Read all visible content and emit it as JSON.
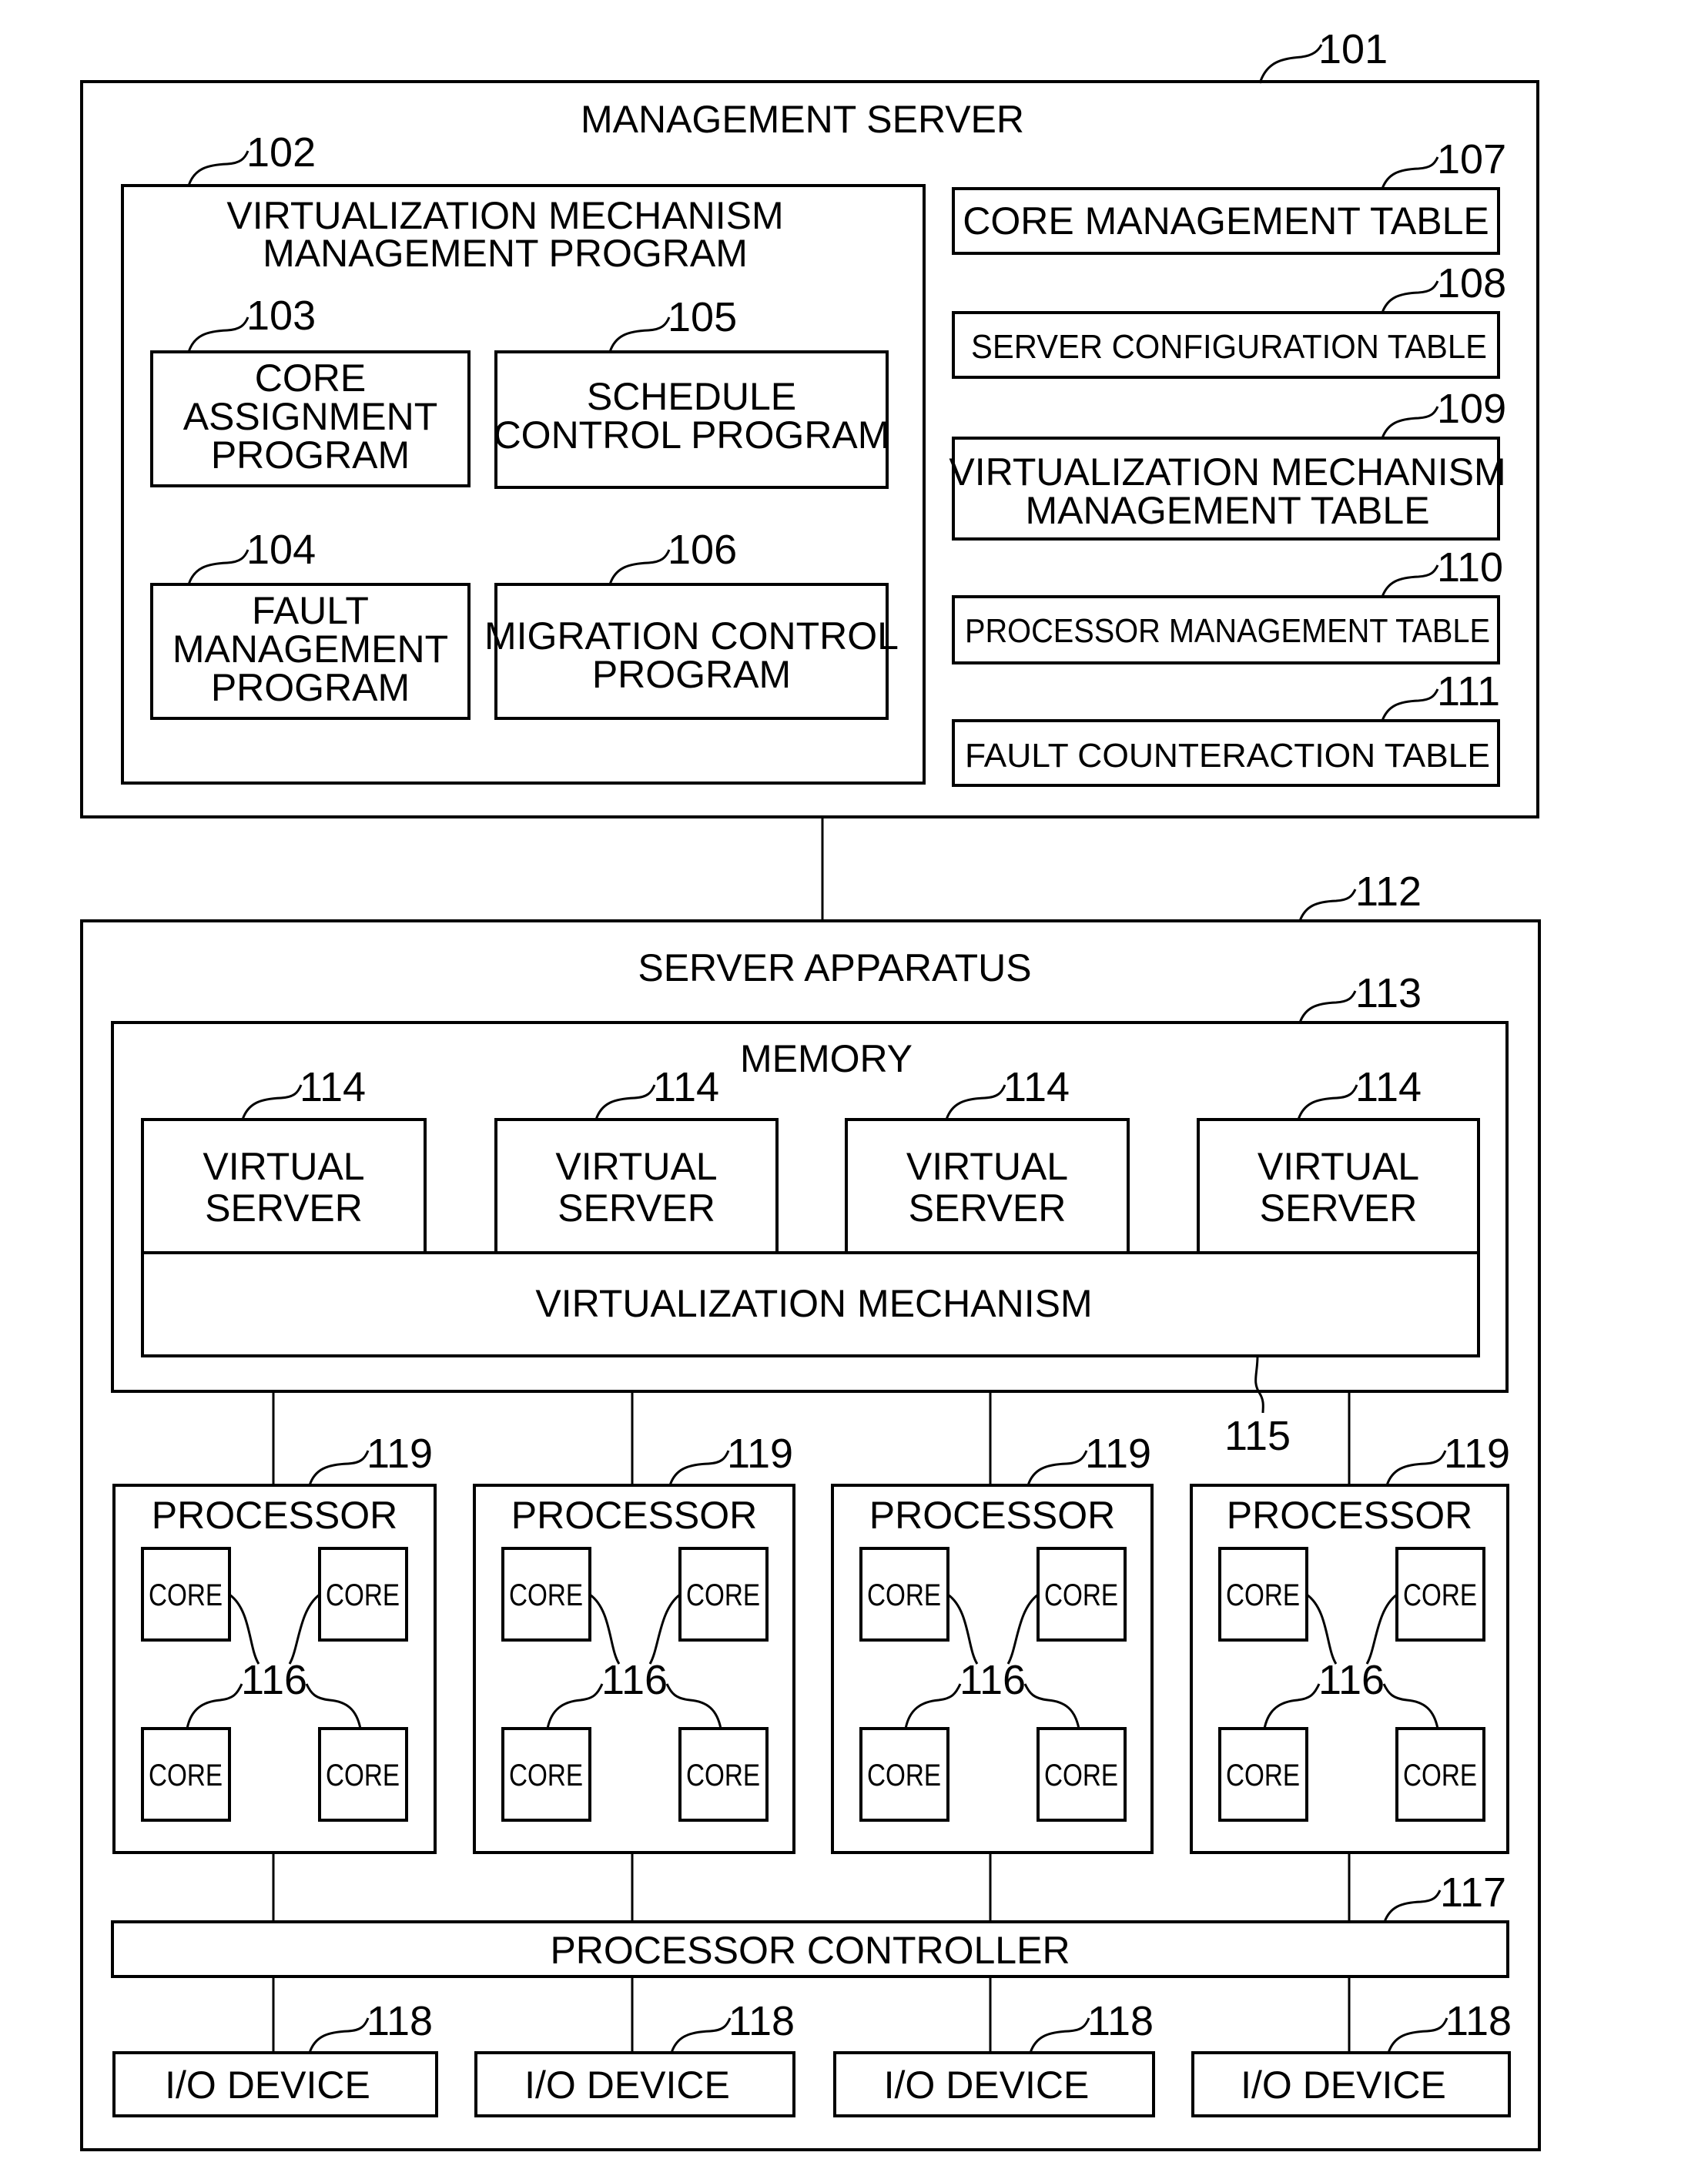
{
  "management_server": {
    "ref": "101",
    "title": "MANAGEMENT SERVER",
    "vm_mgmt_program": {
      "ref": "102",
      "title_line1": "VIRTUALIZATION MECHANISM",
      "title_line2": "MANAGEMENT PROGRAM",
      "programs": [
        {
          "ref": "103",
          "lines": [
            "CORE",
            "ASSIGNMENT",
            "PROGRAM"
          ]
        },
        {
          "ref": "105",
          "lines": [
            "SCHEDULE",
            "CONTROL PROGRAM"
          ]
        },
        {
          "ref": "104",
          "lines": [
            "FAULT",
            "MANAGEMENT",
            "PROGRAM"
          ]
        },
        {
          "ref": "106",
          "lines": [
            "MIGRATION CONTROL",
            "PROGRAM"
          ]
        }
      ]
    },
    "tables": [
      {
        "ref": "107",
        "lines": [
          "CORE MANAGEMENT TABLE"
        ]
      },
      {
        "ref": "108",
        "lines": [
          "SERVER CONFIGURATION TABLE"
        ]
      },
      {
        "ref": "109",
        "lines": [
          "VIRTUALIZATION MECHANISM",
          "MANAGEMENT TABLE"
        ]
      },
      {
        "ref": "110",
        "lines": [
          "PROCESSOR MANAGEMENT TABLE"
        ]
      },
      {
        "ref": "111",
        "lines": [
          "FAULT COUNTERACTION TABLE"
        ]
      }
    ]
  },
  "server_apparatus": {
    "ref": "112",
    "title": "SERVER APPARATUS",
    "memory": {
      "ref": "113",
      "title": "MEMORY",
      "virtual_servers": [
        {
          "ref": "114",
          "lines": [
            "VIRTUAL",
            "SERVER"
          ]
        },
        {
          "ref": "114",
          "lines": [
            "VIRTUAL",
            "SERVER"
          ]
        },
        {
          "ref": "114",
          "lines": [
            "VIRTUAL",
            "SERVER"
          ]
        },
        {
          "ref": "114",
          "lines": [
            "VIRTUAL",
            "SERVER"
          ]
        }
      ],
      "virtualization_mechanism": {
        "ref": "115",
        "label": "VIRTUALIZATION MECHANISM"
      }
    },
    "processors": [
      {
        "ref": "119",
        "title": "PROCESSOR",
        "core_ref": "116",
        "cores": [
          "CORE",
          "CORE",
          "CORE",
          "CORE"
        ]
      },
      {
        "ref": "119",
        "title": "PROCESSOR",
        "core_ref": "116",
        "cores": [
          "CORE",
          "CORE",
          "CORE",
          "CORE"
        ]
      },
      {
        "ref": "119",
        "title": "PROCESSOR",
        "core_ref": "116",
        "cores": [
          "CORE",
          "CORE",
          "CORE",
          "CORE"
        ]
      },
      {
        "ref": "119",
        "title": "PROCESSOR",
        "core_ref": "116",
        "cores": [
          "CORE",
          "CORE",
          "CORE",
          "CORE"
        ]
      }
    ],
    "processor_controller": {
      "ref": "117",
      "label": "PROCESSOR CONTROLLER"
    },
    "io_devices": [
      {
        "ref": "118",
        "label": "I/O DEVICE"
      },
      {
        "ref": "118",
        "label": "I/O DEVICE"
      },
      {
        "ref": "118",
        "label": "I/O DEVICE"
      },
      {
        "ref": "118",
        "label": "I/O DEVICE"
      }
    ]
  }
}
